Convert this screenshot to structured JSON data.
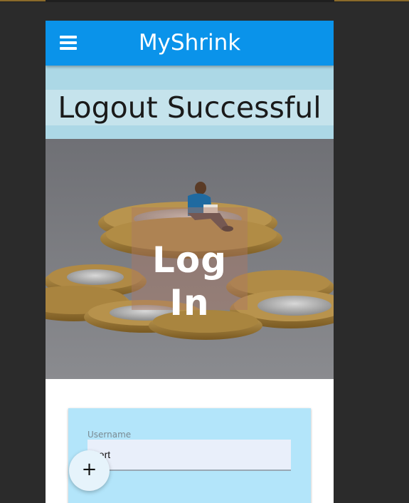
{
  "app": {
    "title": "MyShrink",
    "menu_icon": "hamburger-icon"
  },
  "notice": {
    "message": "Logout Successful"
  },
  "hero": {
    "heading": "Log In",
    "image": "man-sitting-on-coins-illustration"
  },
  "login_form": {
    "username_label": "Username",
    "username_value": "bert"
  },
  "fab": {
    "icon": "plus-icon",
    "symbol": "+"
  },
  "colors": {
    "appbar": "#0a93ea",
    "notice_bg": "#acd8e6",
    "card_bg": "#b3e5fa"
  }
}
